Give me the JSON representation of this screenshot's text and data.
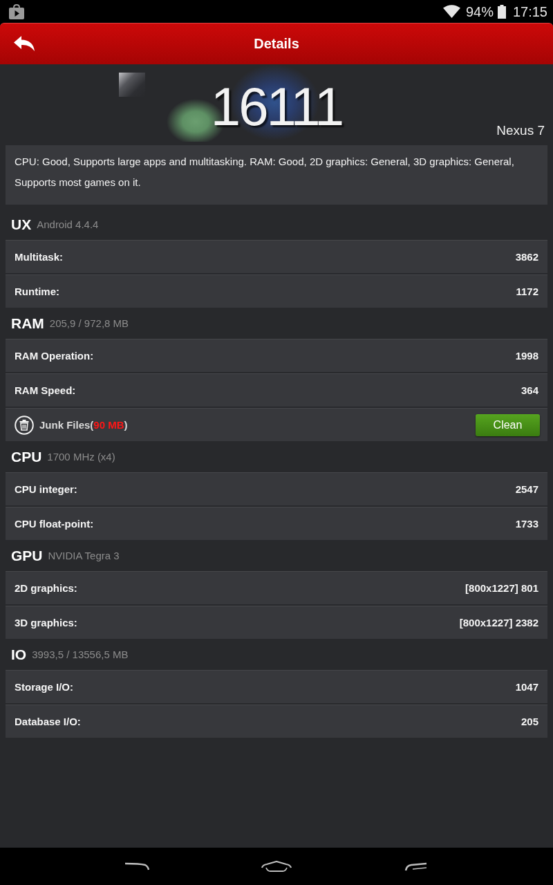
{
  "status_bar": {
    "battery": "94%",
    "time": "17:15"
  },
  "header": {
    "title": "Details"
  },
  "score": {
    "value": "16111",
    "device": "Nexus 7"
  },
  "summary": "CPU: Good, Supports large apps and multitasking. RAM: Good, 2D graphics: General, 3D graphics: General, Supports most games on it.",
  "sections": [
    {
      "title": "UX",
      "subtitle": "Android 4.4.4",
      "rows": [
        {
          "kind": "score",
          "label": "Multitask:",
          "value": "3862"
        },
        {
          "kind": "score",
          "label": "Runtime:",
          "value": "1172"
        }
      ]
    },
    {
      "title": "RAM",
      "subtitle": "205,9 / 972,8 MB",
      "rows": [
        {
          "kind": "score",
          "label": "RAM Operation:",
          "value": "1998"
        },
        {
          "kind": "score",
          "label": "RAM Speed:",
          "value": "364"
        },
        {
          "kind": "junk",
          "label": "Junk Files(",
          "amount": "90 MB",
          "label_end": ")",
          "button": "Clean"
        }
      ]
    },
    {
      "title": "CPU",
      "subtitle": "1700 MHz (x4)",
      "rows": [
        {
          "kind": "score",
          "label": "CPU integer:",
          "value": "2547"
        },
        {
          "kind": "score",
          "label": "CPU float-point:",
          "value": "1733"
        }
      ]
    },
    {
      "title": "GPU",
      "subtitle": "NVIDIA Tegra 3",
      "rows": [
        {
          "kind": "score",
          "label": "2D graphics:",
          "value": "[800x1227] 801"
        },
        {
          "kind": "score",
          "label": "3D graphics:",
          "value": "[800x1227] 2382"
        }
      ]
    },
    {
      "title": "IO",
      "subtitle": "3993,5 / 13556,5 MB",
      "rows": [
        {
          "kind": "score",
          "label": "Storage I/O:",
          "value": "1047"
        },
        {
          "kind": "score",
          "label": "Database I/O:",
          "value": "205"
        }
      ]
    }
  ]
}
